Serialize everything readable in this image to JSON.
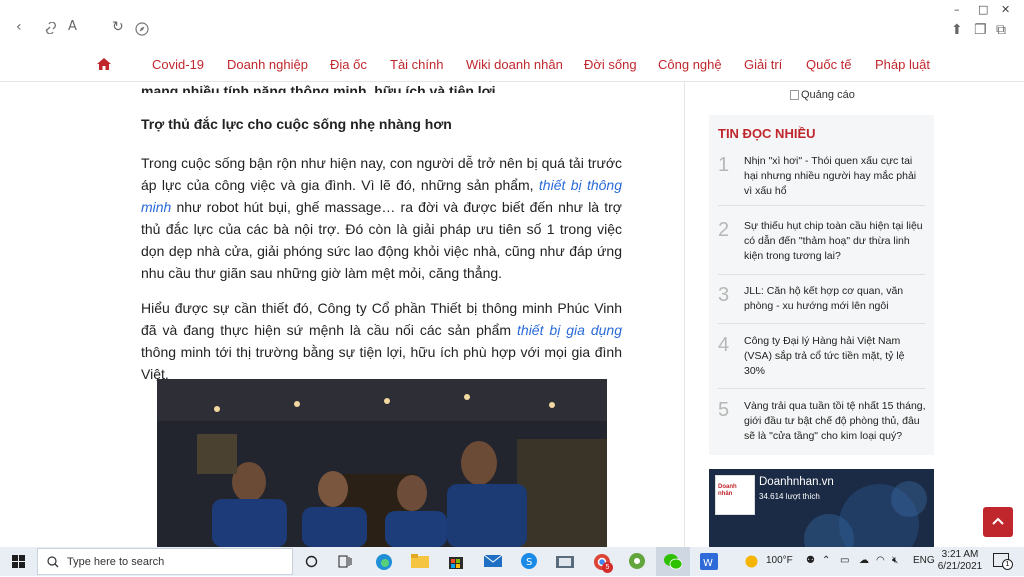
{
  "browser": {
    "icons": [
      "back-icon",
      "link-icon",
      "text-size-icon",
      "refresh-icon",
      "compass-icon",
      "share-icon",
      "collections-icon",
      "extensions-icon"
    ]
  },
  "nav": {
    "items": [
      "Covid-19",
      "Doanh nghiệp",
      "Địa ốc",
      "Tài chính",
      "Wiki doanh nhân",
      "Đời sống",
      "Công nghệ",
      "Giải trí",
      "Quốc tế",
      "Pháp luật"
    ]
  },
  "article": {
    "cut_line": "mang nhiều tính năng thông minh, hữu ích và tiện lợi.",
    "subheading": "Trợ thủ đắc lực cho cuộc sống nhẹ nhàng hơn",
    "p1_before": "Trong cuộc sống bận rộn như hiện nay, con người dễ trở nên bị quá tải trước áp lực của công việc và gia đình. Vì lẽ đó, những sản phẩm, ",
    "p1_link": "thiết bị thông minh",
    "p1_after": " như robot hút bụi, ghế massage… ra đời và được biết đến như là trợ thủ đắc lực của các bà nội trợ. Đó còn là giải pháp ưu tiên số 1 trong việc dọn dẹp nhà cửa, giải phóng sức lao động khỏi việc nhà, cũng như đáp ứng nhu cầu thư giãn sau những giờ làm mệt mỏi, căng thẳng.",
    "p2_before": "Hiểu được sự cần thiết đó, Công ty Cổ phần Thiết bị thông minh Phúc Vinh đã và đang thực hiện sứ mệnh là cầu nối các sản phẩm ",
    "p2_link": "thiết bị gia dụng",
    "p2_after": " thông minh tới thị trường bằng sự tiện lợi, hữu ích phù hợp với mọi gia đình Việt."
  },
  "sidebar": {
    "ad_label": "Quảng cáo",
    "title": "TIN ĐỌC NHIỀU",
    "items": [
      {
        "num": "1",
        "text": "Nhịn \"xì hơi\" - Thói quen xấu cực tai hại nhưng nhiều người hay mắc phải vì xấu hổ"
      },
      {
        "num": "2",
        "text": "Sự thiếu hụt chip toàn cầu hiện tại liệu có dẫn đến \"thảm hoạ\" dư thừa linh kiện trong tương lai?"
      },
      {
        "num": "3",
        "text": "JLL: Căn hộ kết hợp cơ quan, văn phòng - xu hướng mới lên ngôi"
      },
      {
        "num": "4",
        "text": "Công ty Đại lý Hàng hải Việt Nam (VSA) sắp trả cổ tức tiền mặt, tỷ lệ 30%"
      },
      {
        "num": "5",
        "text": "Vàng trải qua tuần tồi tệ nhất 15 tháng, giới đầu tư bật chế độ phòng thủ, đâu sẽ là \"cửa tầng\" cho kim loại quý?"
      }
    ],
    "fb_name": "Doanhnhan.vn",
    "fb_likes": "34.614 lượt thích"
  },
  "taskbar": {
    "search_placeholder": "Type here to search",
    "weather": "100°F",
    "lang": "ENG",
    "time": "3:21 AM",
    "date": "6/21/2021",
    "notification_count": "1",
    "mail_badge": "5"
  },
  "colors": {
    "brand_red": "#c0272d",
    "link_blue": "#2a6ad8",
    "taskbar": "#e9eef4"
  }
}
